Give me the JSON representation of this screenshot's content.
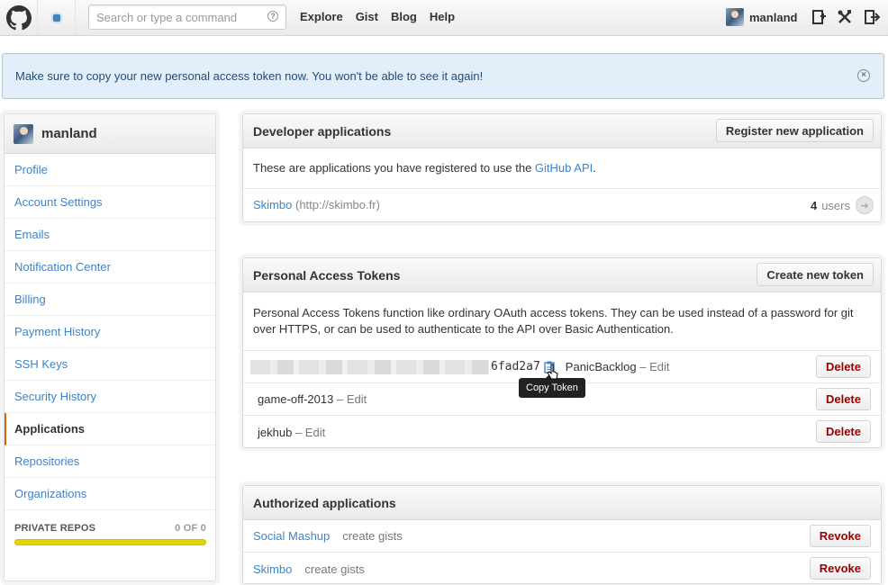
{
  "header": {
    "search_placeholder": "Search or type a command",
    "search_help": "?",
    "nav": [
      "Explore",
      "Gist",
      "Blog",
      "Help"
    ],
    "username": "manland"
  },
  "flash": {
    "message": "Make sure to copy your new personal access token now. You won't be able to see it again!",
    "close": "×"
  },
  "sidebar": {
    "username": "manland",
    "items": [
      "Profile",
      "Account Settings",
      "Emails",
      "Notification Center",
      "Billing",
      "Payment History",
      "SSH Keys",
      "Security History",
      "Applications",
      "Repositories",
      "Organizations"
    ],
    "active": "Applications",
    "private_repos_label": "PRIVATE REPOS",
    "private_repos_value": "0 OF 0",
    "private_repos_fraction": 0
  },
  "developer_apps": {
    "title": "Developer applications",
    "button": "Register new application",
    "description_prefix": "These are applications you have registered to use the ",
    "description_link": "GitHub API",
    "description_suffix": ".",
    "app_name": "Skimbo",
    "app_url": "(http://skimbo.fr)",
    "user_count": "4",
    "users_label": "users",
    "arrow": "➜"
  },
  "tokens": {
    "title": "Personal Access Tokens",
    "button": "Create new token",
    "description": "Personal Access Tokens function like ordinary OAuth access tokens. They can be used instead of a password for git over HTTPS, or can be used to authenticate to the API over Basic Authentication.",
    "token_visible": "6fad2a7",
    "tooltip": "Copy Token",
    "rows": [
      {
        "name": "PanicBacklog",
        "sep": "–",
        "edit": "Edit",
        "delete": "Delete"
      },
      {
        "name": "game-off-2013",
        "sep": "–",
        "edit": "Edit",
        "delete": "Delete"
      },
      {
        "name": "jekhub",
        "sep": "–",
        "edit": "Edit",
        "delete": "Delete"
      }
    ]
  },
  "authorized_apps": {
    "title": "Authorized applications",
    "rows": [
      {
        "name": "Social Mashup",
        "scope": "create gists",
        "revoke": "Revoke"
      },
      {
        "name": "Skimbo",
        "scope": "create gists",
        "revoke": "Revoke"
      }
    ]
  },
  "colors": {
    "link": "#4183c4",
    "flash_bg": "#e2eef9",
    "delete_text": "#990000",
    "progress": "#e5d400",
    "active_marker": "#d26911"
  }
}
